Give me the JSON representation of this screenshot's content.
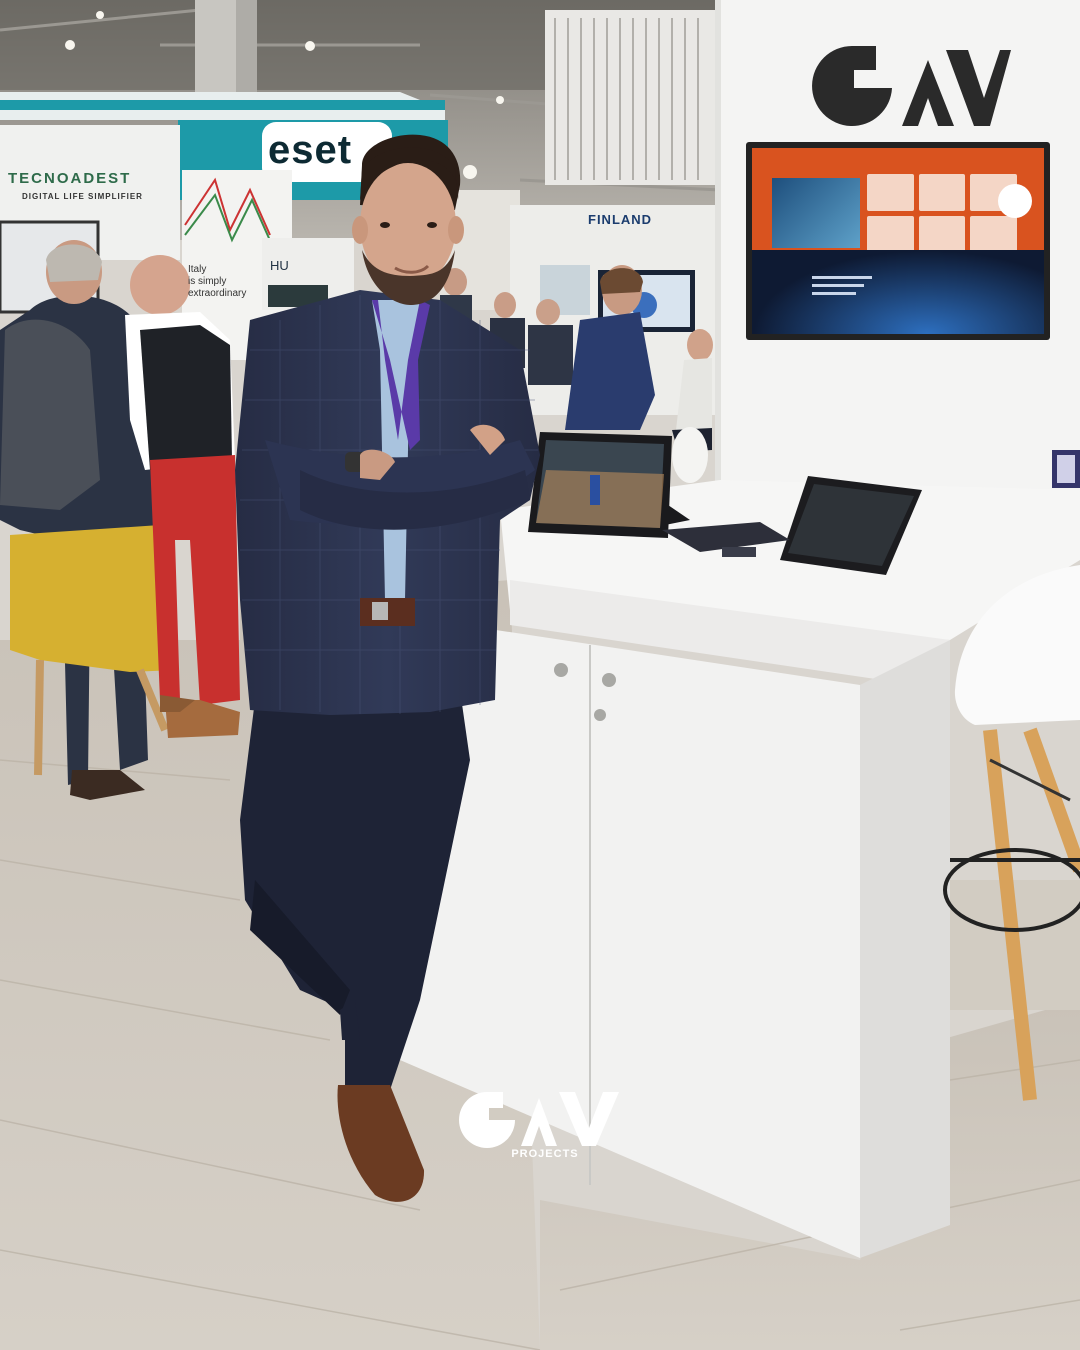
{
  "photo": {
    "subject": "",
    "watermark": {
      "brand": "GAV",
      "sub_label": "PROJECTS"
    },
    "booth_logo": {
      "brand": "GAV"
    },
    "background_signs": {
      "tecnoadest_name": "TECNOADEST",
      "tecnoadest_tagline": "DIGITAL LIFE SIMPLIFIER",
      "eset_name": "eset",
      "italy_line1": "Italy",
      "italy_line2": "is simply",
      "italy_line3": "extraordinary",
      "hu_text": "HU",
      "finland_text": "FINLAND"
    }
  },
  "colors": {
    "booth_white": "#f4f4f4",
    "floor": "#cfc8be",
    "jacket": "#2b3450",
    "trousers": "#1e2336",
    "tv_orange": "#d9531f",
    "eset_teal": "#1d9aa8"
  }
}
